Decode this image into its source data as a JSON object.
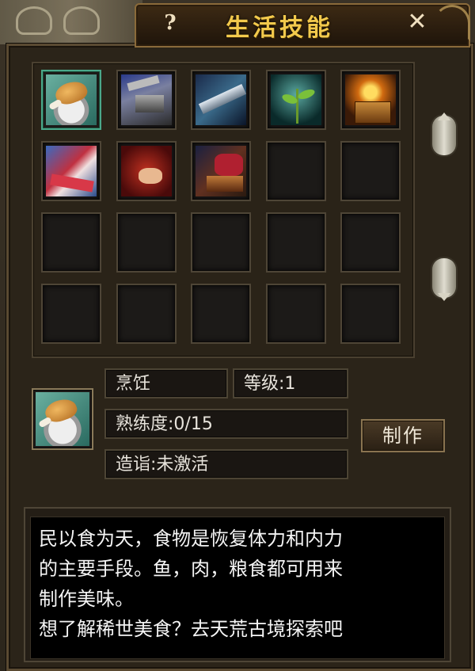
{
  "window": {
    "title": "生活技能",
    "help_label": "?",
    "close_label": "✕"
  },
  "skills_grid": {
    "rows": 4,
    "cols": 5,
    "slots": [
      {
        "icon": "roast-chicken-leg-icon",
        "selected": true
      },
      {
        "icon": "anvil-hammer-icon",
        "selected": false
      },
      {
        "icon": "blade-icon",
        "selected": false
      },
      {
        "icon": "sprout-plant-icon",
        "selected": false
      },
      {
        "icon": "gold-chest-icon",
        "selected": false
      },
      {
        "icon": "silk-ribbon-icon",
        "selected": false
      },
      {
        "icon": "embroidery-needle-icon",
        "selected": false
      },
      {
        "icon": "cloth-book-icon",
        "selected": false
      },
      {
        "icon": "",
        "selected": false
      },
      {
        "icon": "",
        "selected": false
      },
      {
        "icon": "",
        "selected": false
      },
      {
        "icon": "",
        "selected": false
      },
      {
        "icon": "",
        "selected": false
      },
      {
        "icon": "",
        "selected": false
      },
      {
        "icon": "",
        "selected": false
      },
      {
        "icon": "",
        "selected": false
      },
      {
        "icon": "",
        "selected": false
      },
      {
        "icon": "",
        "selected": false
      },
      {
        "icon": "",
        "selected": false
      },
      {
        "icon": "",
        "selected": false
      }
    ]
  },
  "detail": {
    "skill_name": "烹饪",
    "level": "等级:1",
    "proficiency": "熟练度:0/15",
    "mastery": "造诣:未激活",
    "make_button": "制作",
    "icon": "roast-chicken-leg-icon"
  },
  "description": {
    "lines": [
      "民以食为天，食物是恢复体力和内力",
      "的主要手段。鱼，肉，粮食都可用来",
      "制作美味。",
      "想了解稀世美食？去天荒古境探索吧"
    ]
  },
  "colors": {
    "title": "#f2c94c",
    "selected_border": "#4aa88a",
    "text": "#e8e4dc"
  }
}
